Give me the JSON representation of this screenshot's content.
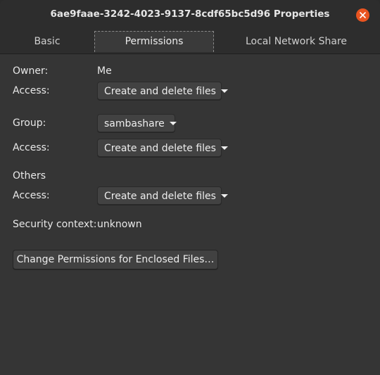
{
  "window": {
    "title": "6ae9faae-3242-4023-9137-8cdf65bc5d96 Properties",
    "close_icon": "close-icon",
    "accent_color": "#e95420"
  },
  "tabs": [
    {
      "label": "Basic"
    },
    {
      "label": "Permissions",
      "active": true
    },
    {
      "label": "Local Network Share"
    }
  ],
  "owner": {
    "label": "Owner:",
    "value": "Me"
  },
  "owner_access": {
    "label": "Access:",
    "value": "Create and delete files"
  },
  "group": {
    "label": "Group:",
    "value": "sambashare"
  },
  "group_access": {
    "label": "Access:",
    "value": "Create and delete files"
  },
  "others": {
    "label": "Others"
  },
  "others_access": {
    "label": "Access:",
    "value": "Create and delete files"
  },
  "security": {
    "label": "Security context:",
    "value": "unknown"
  },
  "enclosed_button": {
    "label": "Change Permissions for Enclosed Files…"
  }
}
